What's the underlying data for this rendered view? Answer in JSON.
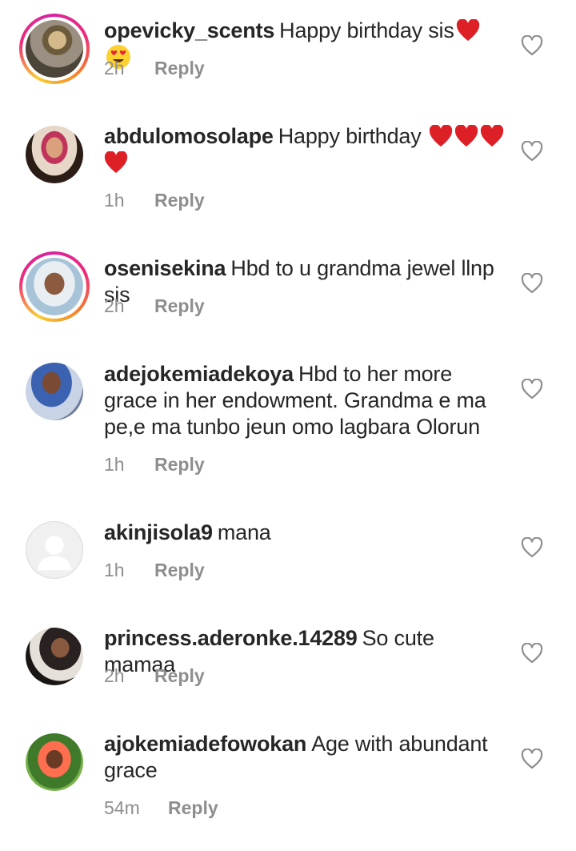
{
  "comments": [
    {
      "username": "opevicky_scents",
      "text": "Happy birthday sis",
      "emoji": [
        "red-heart",
        "heart-eyes"
      ],
      "time": "2h",
      "reply": "Reply",
      "story_ring": true
    },
    {
      "username": "abdulomosolape",
      "text": "Happy birthday",
      "emoji": [
        "red-heart",
        "red-heart",
        "red-heart",
        "red-heart"
      ],
      "time": "1h",
      "reply": "Reply",
      "story_ring": false
    },
    {
      "username": "osenisekina",
      "text": "Hbd to u grandma jewel llnp sis",
      "emoji": [],
      "time": "2h",
      "reply": "Reply",
      "story_ring": true
    },
    {
      "username": "adejokemiadekoya",
      "text": "Hbd to her more grace in her endowment. Grandma e ma pe,e ma tunbo jeun omo lagbara Olorun",
      "emoji": [],
      "time": "1h",
      "reply": "Reply",
      "story_ring": false
    },
    {
      "username": "akinjisola9",
      "text": "mana",
      "emoji": [],
      "time": "1h",
      "reply": "Reply",
      "story_ring": false,
      "default_avatar": true
    },
    {
      "username": "princess.aderonke.14289",
      "text": "So cute mamaa",
      "emoji": [],
      "time": "2h",
      "reply": "Reply",
      "story_ring": false
    },
    {
      "username": "ajokemiadefowokan",
      "text": "Age with abundant grace",
      "emoji": [],
      "time": "54m",
      "reply": "Reply",
      "story_ring": false
    }
  ],
  "icons": {
    "like": "heart-outline-icon",
    "reaction_heart": "red-heart-emoji",
    "reaction_face": "heart-eyes-emoji"
  },
  "colors": {
    "text": "#262626",
    "meta": "#8e8e8e",
    "heart": "#e0245e",
    "ring_start": "#f9ce34",
    "ring_end": "#ee2a7b"
  }
}
